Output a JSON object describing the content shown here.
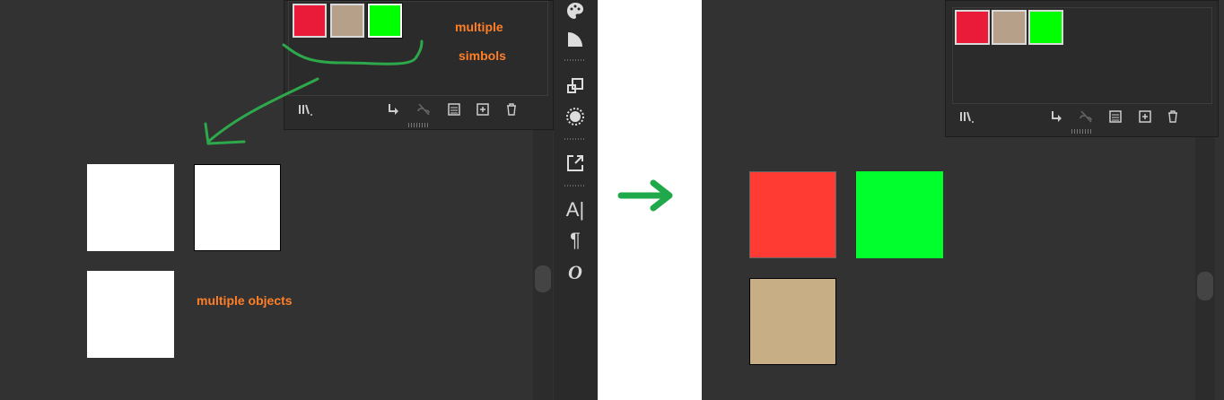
{
  "left": {
    "symbols_panel": {
      "swatches": [
        {
          "color": "#ea1b38",
          "selected": false
        },
        {
          "color": "#b6a089",
          "selected": false
        },
        {
          "color": "#00ff00",
          "selected": true
        }
      ],
      "icons": [
        "libraries-icon",
        "place-symbol-icon",
        "break-link-icon",
        "symbol-options-icon",
        "new-symbol-icon",
        "delete-icon"
      ]
    },
    "annotations": {
      "symbols_line1": "multiple",
      "symbols_line2": "simbols",
      "objects": "multiple objects"
    },
    "objects": [
      {
        "color": "#ffffff"
      },
      {
        "color": "#ffffff"
      },
      {
        "color": "#ffffff"
      }
    ]
  },
  "tool_strip": {
    "icons": [
      "palette-icon",
      "gradient-icon",
      "transform-icon",
      "appearance-icon",
      "export-icon",
      "character-icon",
      "paragraph-icon",
      "opentype-icon"
    ]
  },
  "right": {
    "symbols_panel": {
      "swatches": [
        {
          "color": "#ea1b38",
          "selected": false
        },
        {
          "color": "#b6a089",
          "selected": false
        },
        {
          "color": "#00ff00",
          "selected": false
        }
      ]
    },
    "objects": [
      {
        "color": "#ff3b34"
      },
      {
        "color": "#00ff2c"
      },
      {
        "color": "#c8ae85"
      }
    ]
  },
  "colors": {
    "canvas": "#323232",
    "panel": "#2b2b2b",
    "annotation_text": "#ff7f27",
    "annotation_stroke": "#2da84b",
    "arrow": "#1fa94a"
  }
}
